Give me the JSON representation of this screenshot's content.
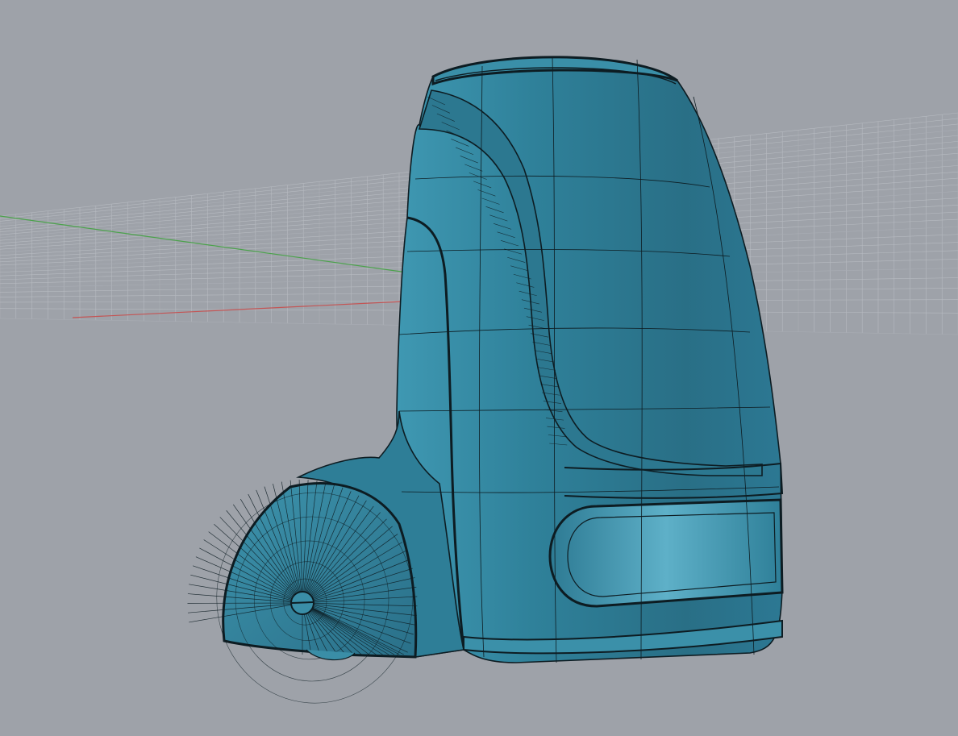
{
  "viewport": {
    "projection": "perspective",
    "display_mode": "shaded-with-isocurves",
    "background_color": "#9ea2a9",
    "grid_color": "#b7bbc1",
    "grid_major_color": "#a9adb4",
    "x_axis_color": "#c45454",
    "y_axis_color": "#4ba24b",
    "model_color": "#2f7f98",
    "model_highlight_color": "#5fb0c8",
    "model_shadow_color": "#1f5b6e",
    "edge_color": "#0d1c22"
  },
  "model": {
    "parts": [
      {
        "name": "main-body",
        "icon": "cylinder-shell-icon"
      },
      {
        "name": "top-rim",
        "icon": "ring-icon"
      },
      {
        "name": "side-fillet-band",
        "icon": "fillet-icon"
      },
      {
        "name": "lower-slot",
        "icon": "slot-icon"
      },
      {
        "name": "wheel-housing",
        "icon": "arch-icon"
      },
      {
        "name": "wheel",
        "icon": "wheel-icon"
      },
      {
        "name": "base-ring",
        "icon": "ring-icon"
      }
    ]
  }
}
